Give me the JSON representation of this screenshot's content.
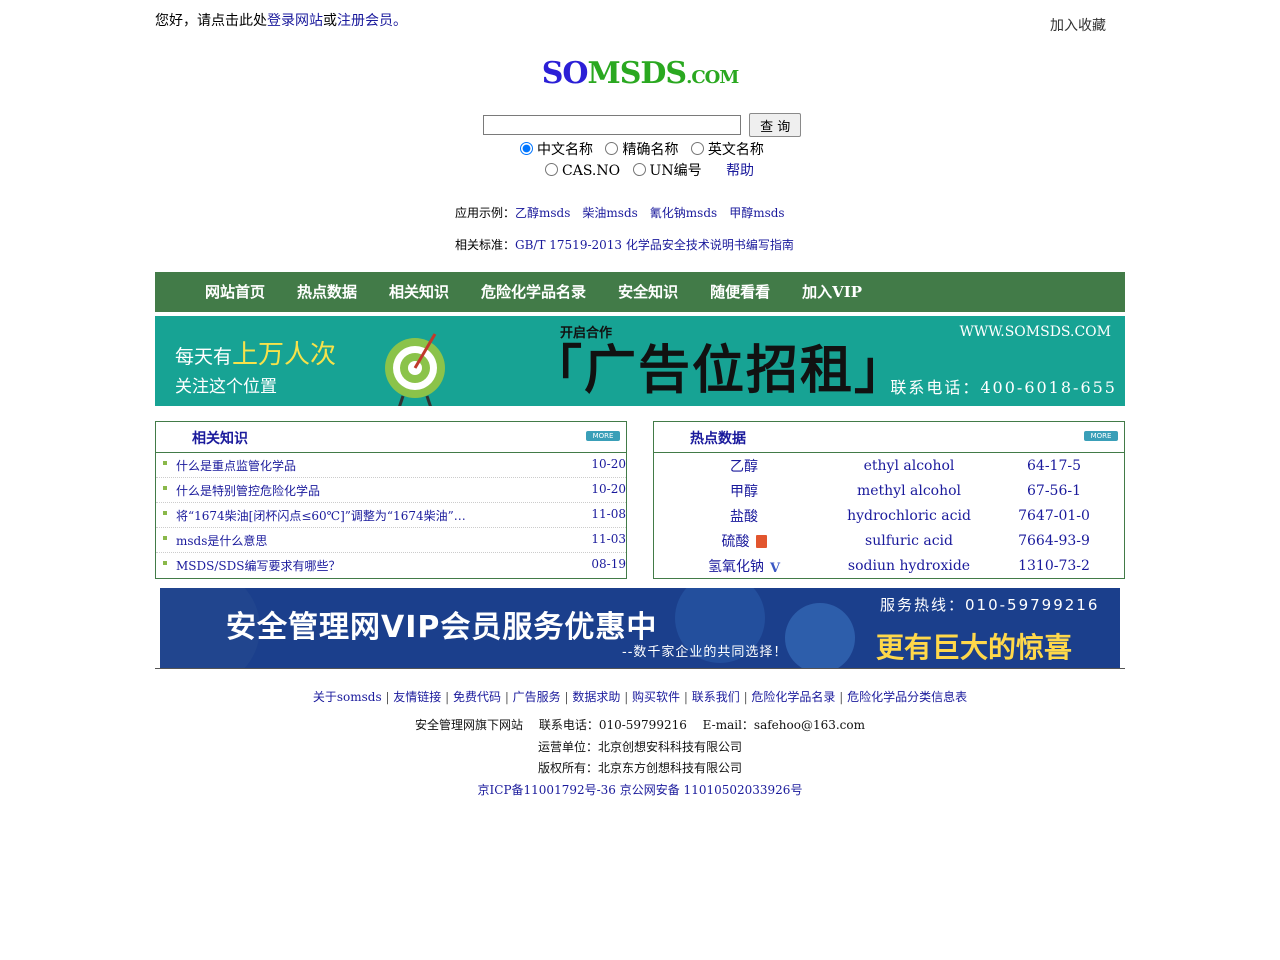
{
  "header": {
    "greeting_prefix": "您好，请点击此处",
    "login_link": "登录网站",
    "or": "或",
    "register_link": "注册会员",
    "suffix": "。",
    "favorite": "加入收藏"
  },
  "logo": {
    "part1": "SO",
    "part2": "MSDS",
    "part3": ".COM"
  },
  "search": {
    "input_value": "",
    "button": "查 询",
    "radios_row1": [
      "中文名称",
      "精确名称",
      "英文名称"
    ],
    "radios_row2": [
      "CAS.NO",
      "UN编号"
    ],
    "selected": "中文名称",
    "help": "帮助"
  },
  "examples": {
    "label": "应用示例：",
    "items": [
      "乙醇msds",
      "柴油msds",
      "氰化钠msds",
      "甲醇msds"
    ]
  },
  "standard": {
    "label": "相关标准：",
    "link": "GB/T 17519-2013 化学品安全技术说明书编写指南"
  },
  "nav": [
    "网站首页",
    "热点数据",
    "相关知识",
    "危险化学品名录",
    "安全知识",
    "随便看看",
    "加入VIP"
  ],
  "ad_banner": {
    "line1a": "每天有",
    "line1b": "上万人次",
    "line2": "关注这个位置",
    "tag": "开启合作",
    "headline": "「广告位招租」",
    "url": "WWW.SOMSDS.COM",
    "phone": "联系电话：400-6018-655"
  },
  "knowledge": {
    "title": "相关知识",
    "more": "MORE",
    "items": [
      {
        "text": "什么是重点监管化学品",
        "date": "10-20"
      },
      {
        "text": "什么是特别管控危险化学品",
        "date": "10-20"
      },
      {
        "text": "将“1674柴油[闭杯闪点≤60℃]”调整为“1674柴油”…",
        "date": "11-08"
      },
      {
        "text": "msds是什么意思",
        "date": "11-03"
      },
      {
        "text": "MSDS/SDS编写要求有哪些？",
        "date": "08-19"
      }
    ]
  },
  "hot": {
    "title": "热点数据",
    "more": "MORE",
    "rows": [
      {
        "cn": "乙醇",
        "en": "ethyl alcohol",
        "cas": "64-17-5",
        "icon": ""
      },
      {
        "cn": "甲醇",
        "en": "methyl alcohol",
        "cas": "67-56-1",
        "icon": ""
      },
      {
        "cn": "盐酸",
        "en": "hydrochloric acid",
        "cas": "7647-01-0",
        "icon": ""
      },
      {
        "cn": "硫酸",
        "en": "sulfuric acid",
        "cas": "7664-93-9",
        "icon": "pdf-icon"
      },
      {
        "cn": "氢氧化钠",
        "en": "sodiun hydroxide",
        "cas": "1310-73-2",
        "icon": "vip-icon"
      }
    ]
  },
  "vip_banner": {
    "title": "安全管理网VIP会员服务优惠中",
    "subtitle": "--数千家企业的共同选择！",
    "hotline": "服务热线：010-59799216",
    "surprise": "更有巨大的惊喜"
  },
  "footer": {
    "links": [
      "关于somsds",
      "友情链接",
      "免费代码",
      "广告服务",
      "数据求助",
      "购买软件",
      "联系我们",
      "危险化学品名录",
      "危险化学品分类信息表"
    ],
    "line1": "安全管理网旗下网站　 联系电话：010-59799216　 E-mail：safehoo@163.com",
    "line2": "运营单位：北京创想安科科技有限公司",
    "line3": "版权所有：北京东方创想科技有限公司",
    "line4": "京ICP备11001792号-36 京公网安备 11010502033926号"
  },
  "colors": {
    "nav_green": "#427b48",
    "link_blue": "#1a1a9c",
    "ad_teal": "#17a394",
    "vip_blue": "#1b3f8c"
  }
}
